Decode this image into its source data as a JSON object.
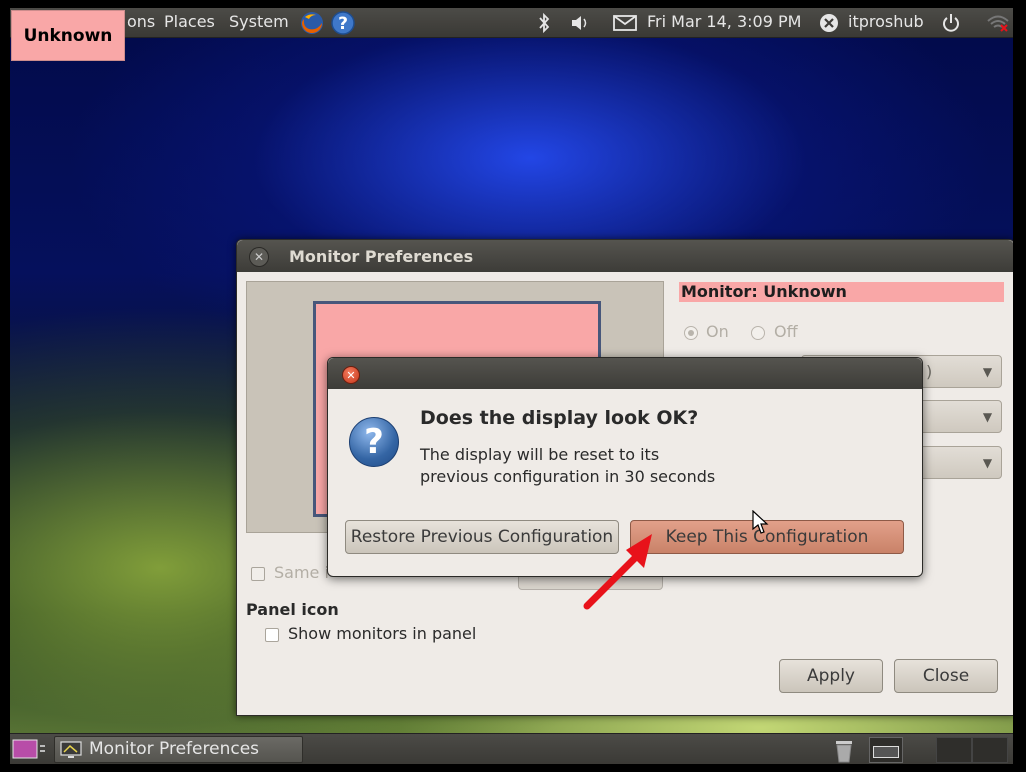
{
  "top_panel": {
    "menus": [
      "ons",
      "Places",
      "System"
    ],
    "clock": "Fri Mar 14,  3:09 PM",
    "user": "itproshub"
  },
  "overlay_label": "Unknown",
  "main_window": {
    "title": "Monitor Preferences",
    "monitor_heading": "Monitor: Unknown",
    "on_label": "On",
    "off_label": "Off",
    "combo1_value": ")",
    "same_image_label": "Same i",
    "panel_icon_heading": "Panel icon",
    "show_monitors_label": "Show monitors in panel",
    "apply_label": "Apply",
    "close_label": "Close"
  },
  "dialog": {
    "heading": "Does the display look OK?",
    "line1": "The display will be reset to its",
    "line2": "previous configuration in 30 seconds",
    "restore_label": "Restore Previous Configuration",
    "keep_label": "Keep This Configuration"
  },
  "taskbar": {
    "task_label": "Monitor Preferences"
  },
  "colors": {
    "accent_highlight": "#f9a7a7",
    "annotation_arrow": "#e8121a"
  }
}
